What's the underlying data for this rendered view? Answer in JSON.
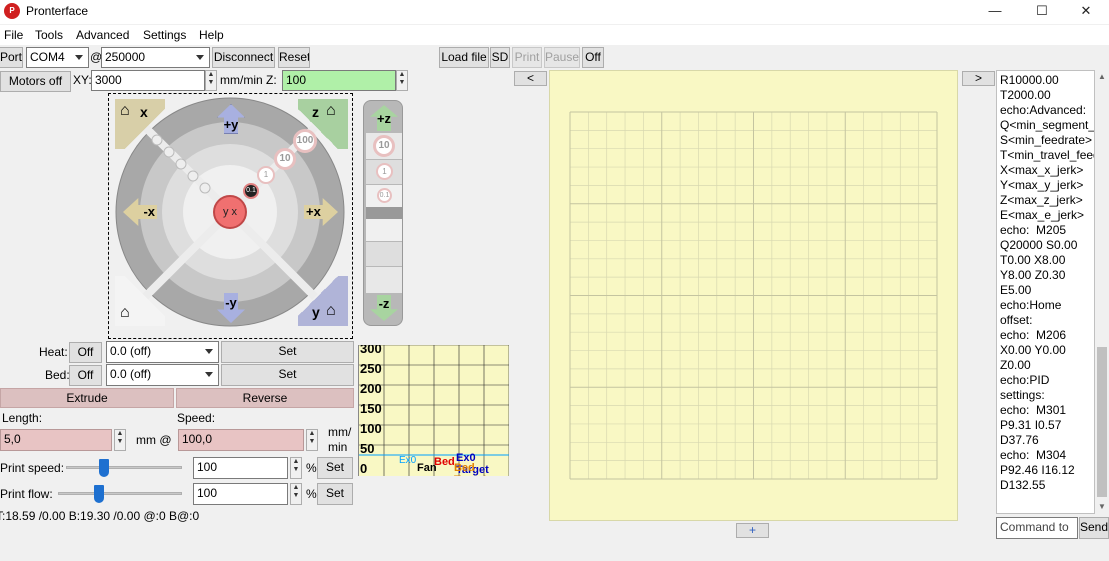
{
  "window": {
    "title": "Pronterface",
    "logo": "P",
    "minimize": "—",
    "maximize": "☐",
    "close": "✕"
  },
  "menu": [
    "File",
    "Tools",
    "Advanced",
    "Settings",
    "Help"
  ],
  "connection": {
    "port_label": "Port",
    "port_value": "COM4",
    "at": "@",
    "baud_value": "250000",
    "disconnect_label": "Disconnect",
    "reset_label": "Reset"
  },
  "print_controls": {
    "load_file": "Load file",
    "sd": "SD",
    "print": "Print",
    "pause": "Pause",
    "off": "Off"
  },
  "motors": {
    "motors_off": "Motors off",
    "xy_label": "XY:",
    "xy_speed": "3000",
    "unit": "mm/min Z:",
    "z_speed": "100"
  },
  "jog": {
    "home_x": "x",
    "home_z": "z",
    "home_y": "y",
    "plus_y": "+y",
    "minus_y": "-y",
    "plus_x": "+x",
    "minus_x": "-x",
    "steps": [
      "100",
      "10",
      "1",
      "0.1"
    ],
    "center": "y x",
    "z_plus": "+z",
    "z_minus": "-z",
    "z_steps": [
      "10",
      "1",
      "0.1"
    ]
  },
  "temperature": {
    "heat_label": "Heat:",
    "heat_off": "Off",
    "heat_value": "0.0 (off)",
    "heat_set": "Set",
    "bed_label": "Bed:",
    "bed_off": "Off",
    "bed_value": "0.0 (off)",
    "bed_set": "Set"
  },
  "graph": {
    "ticks": [
      "300",
      "250",
      "200",
      "150",
      "100",
      "50",
      "0"
    ],
    "legend": {
      "ex0": "Ex0",
      "bed": "Bed",
      "fan": "Fan",
      "ex0_target": "Ex0 Target",
      "bed_target": "Bed Target"
    },
    "colors": {
      "ex0": "#00a0ff",
      "bed": "#e00000",
      "fan": "#000000",
      "ex0_target": "#0000c0",
      "bed_target": "#e08000"
    }
  },
  "extrude": {
    "extrude_label": "Extrude",
    "reverse_label": "Reverse",
    "length_label": "Length:",
    "speed_label": "Speed:",
    "length_value": "5,0",
    "mm_at": "mm @",
    "speed_value": "100,0",
    "speed_unit_1": "mm/",
    "speed_unit_2": "min"
  },
  "print_speed": {
    "label": "Print speed:",
    "value": "100",
    "percent": "%",
    "set": "Set",
    "level": 0.33
  },
  "print_flow": {
    "label": "Print flow:",
    "value": "100",
    "percent": "%",
    "set": "Set",
    "level": 0.33
  },
  "status": "T:18.59 /0.00 B:19.30 /0.00 @:0 B@:0",
  "panel_toggles": {
    "left": "<",
    "right": ">",
    "add": "+"
  },
  "console": {
    "text": "R10000.00\nT2000.00\necho:Advanced: Q<min_segment_time_us> S<min_feedrate> T<min_travel_feedrate> X<max_x_jerk> Y<max_y_jerk> Z<max_z_jerk> E<max_e_jerk>\necho:  M205 Q20000 S0.00 T0.00 X8.00 Y8.00 Z0.30 E5.00\necho:Home offset:\necho:  M206 X0.00 Y0.00 Z0.00\necho:PID settings:\necho:  M301 P9.31 I0.57 D37.76\necho:  M304 P92.46 I16.12 D132.55",
    "command_placeholder": "Command to",
    "send": "Send"
  }
}
